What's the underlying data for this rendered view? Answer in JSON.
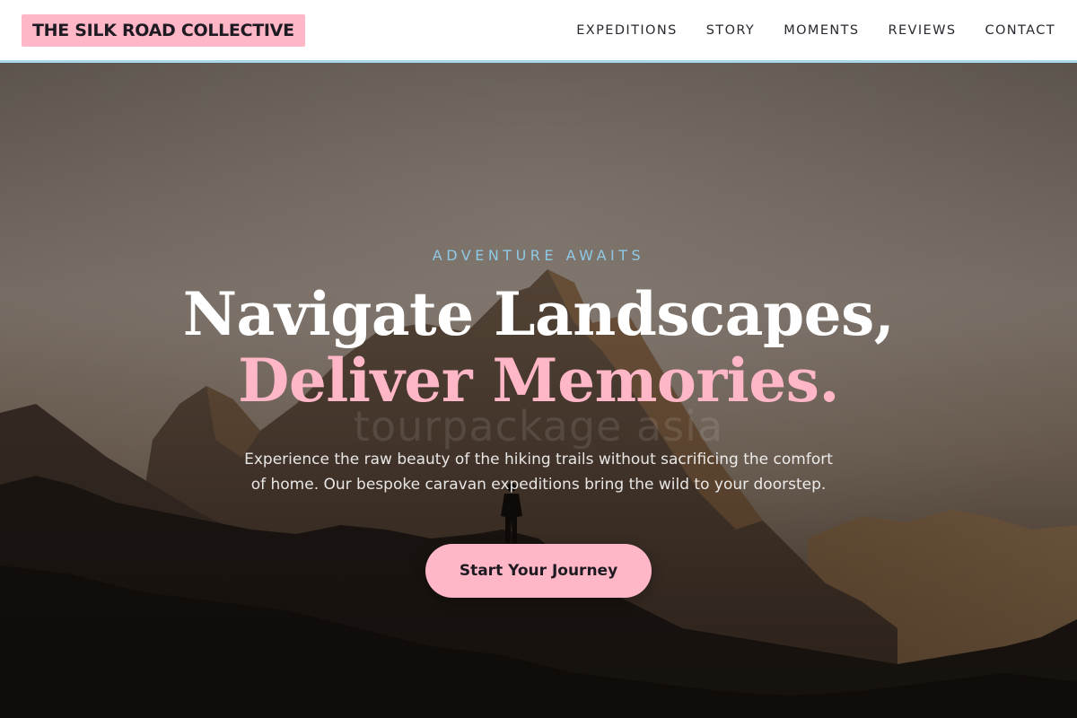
{
  "brand": {
    "name": "THE SILK ROAD COLLECTIVE"
  },
  "nav": {
    "items": [
      {
        "label": "EXPEDITIONS"
      },
      {
        "label": "STORY"
      },
      {
        "label": "MOMENTS"
      },
      {
        "label": "REVIEWS"
      },
      {
        "label": "CONTACT"
      }
    ]
  },
  "hero": {
    "eyebrow": "ADVENTURE AWAITS",
    "headline_line1": "Navigate Landscapes,",
    "headline_line2": "Deliver Memories.",
    "description": "Experience the raw beauty of the hiking trails without sacrificing the comfort of home. Our bespoke caravan expeditions bring the wild to your doorstep.",
    "cta_label": "Start Your Journey",
    "watermark": "tourpackage asia"
  },
  "colors": {
    "accent_pink": "#ffb6c6",
    "accent_blue": "#8fc9e6",
    "nav_border": "#a8d8ea",
    "text_dark": "#1e1a22"
  }
}
